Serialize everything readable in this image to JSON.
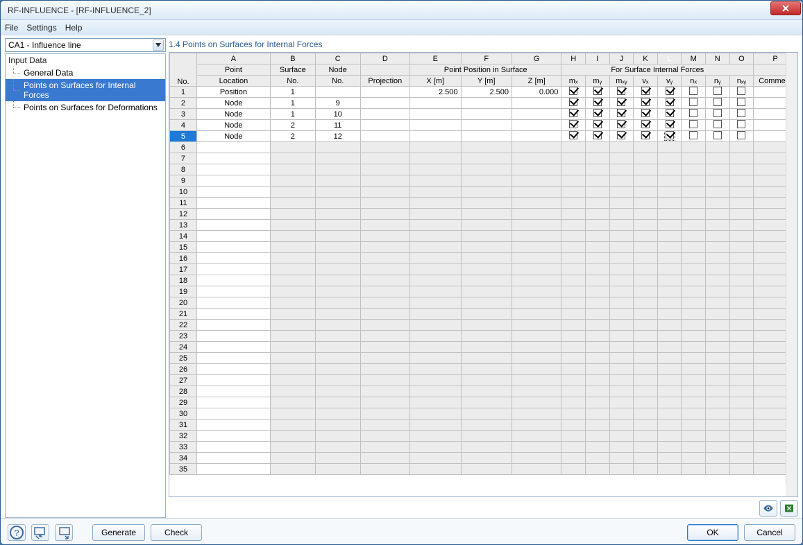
{
  "window": {
    "title": "RF-INFLUENCE - [RF-INFLUENCE_2]"
  },
  "menubar": {
    "file": "File",
    "settings": "Settings",
    "help": "Help"
  },
  "sidebar": {
    "combo_value": "CA1 - Influence line",
    "tree_root": "Input Data",
    "tree_items": [
      {
        "label": "General Data",
        "selected": false
      },
      {
        "label": "Points on Surfaces for Internal Forces",
        "selected": true
      },
      {
        "label": "Points on Surfaces for Deformations",
        "selected": false
      }
    ]
  },
  "content": {
    "section_title": "1.4 Points on Surfaces for Internal Forces",
    "col_letters": [
      "A",
      "B",
      "C",
      "D",
      "E",
      "F",
      "G",
      "H",
      "I",
      "J",
      "K",
      "L",
      "M",
      "N",
      "O",
      "P"
    ],
    "selected_col": "L",
    "group_headers": {
      "row_label": "No.",
      "point": "Point",
      "surface": "Surface",
      "node": "Node",
      "position_group": "Point Position in Surface",
      "forces_group": "For Surface Internal Forces"
    },
    "sub_headers": {
      "location": "Location",
      "surface_no": "No.",
      "node_no": "No.",
      "projection": "Projection",
      "x": "X [m]",
      "y": "Y [m]",
      "z": "Z [m]",
      "mx": "mₓ",
      "my": "mᵧ",
      "mxy": "mₓᵧ",
      "vx": "vₓ",
      "vy": "vᵧ",
      "nx": "nₓ",
      "ny": "nᵧ",
      "nxy": "nₓᵧ",
      "comment": "Comment"
    },
    "selected_row": 5,
    "rows": [
      {
        "no": 1,
        "loc": "Position",
        "surf": "1",
        "node": "",
        "proj": "",
        "x": "2.500",
        "y": "2.500",
        "z": "0.000",
        "chk": [
          true,
          true,
          true,
          true,
          true,
          false,
          false,
          false
        ]
      },
      {
        "no": 2,
        "loc": "Node",
        "surf": "1",
        "node": "9",
        "proj": "",
        "x": "",
        "y": "",
        "z": "",
        "chk": [
          true,
          true,
          true,
          true,
          true,
          false,
          false,
          false
        ]
      },
      {
        "no": 3,
        "loc": "Node",
        "surf": "1",
        "node": "10",
        "proj": "",
        "x": "",
        "y": "",
        "z": "",
        "chk": [
          true,
          true,
          true,
          true,
          true,
          false,
          false,
          false
        ]
      },
      {
        "no": 4,
        "loc": "Node",
        "surf": "2",
        "node": "11",
        "proj": "",
        "x": "",
        "y": "",
        "z": "",
        "chk": [
          true,
          true,
          true,
          true,
          true,
          false,
          false,
          false
        ]
      },
      {
        "no": 5,
        "loc": "Node",
        "surf": "2",
        "node": "12",
        "proj": "",
        "x": "",
        "y": "",
        "z": "",
        "chk": [
          true,
          true,
          true,
          true,
          true,
          false,
          false,
          false
        ]
      }
    ],
    "total_rows": 35,
    "focused_cell": {
      "row": 5,
      "chk_index": 4
    }
  },
  "buttons": {
    "generate": "Generate",
    "check": "Check",
    "ok": "OK",
    "cancel": "Cancel"
  }
}
